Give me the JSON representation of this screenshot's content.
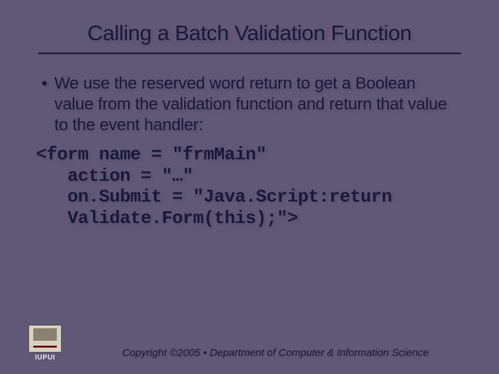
{
  "title": "Calling a Batch Validation Function",
  "bullet": {
    "marker": "•",
    "text": "We use the reserved word return to get a Boolean value from the validation function and return that value to the event handler:"
  },
  "code": {
    "line1": "<form name = \"frmMain\"",
    "line2": "   action = \"…\"",
    "line3": "   on.Submit = \"Java.Script:return",
    "line4": "   Validate.Form(this);\">"
  },
  "footer": {
    "logo_label": "IUPUI",
    "copyright": "Copyright ©2005 • Department of Computer & Information Science"
  }
}
